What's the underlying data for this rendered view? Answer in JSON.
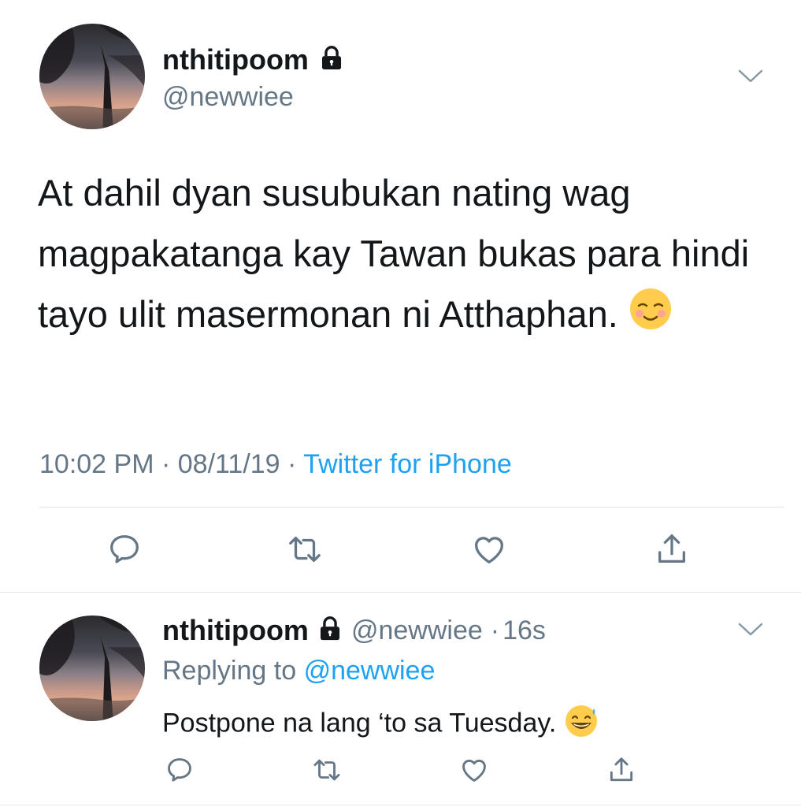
{
  "main_tweet": {
    "display_name": "nthitipoom",
    "handle": "@newwiee",
    "text": "At dahil dyan susubukan nating wag magpakatanga kay Tawan bukas para hindi tayo ulit masermonan ni Atthaphan.",
    "emoji": "relieved-smiling-face",
    "time": "10:02 PM",
    "date": "08/11/19",
    "source": "Twitter for iPhone"
  },
  "reply_tweet": {
    "display_name": "nthitipoom",
    "handle": "@newwiee",
    "age": "16s",
    "replying_prefix": "Replying to",
    "replying_to": "@newwiee",
    "text": "Postpone na lang ‘to sa Tuesday.",
    "emoji": "grinning-sweat-face"
  },
  "colors": {
    "text": "#14171a",
    "secondary": "#657786",
    "link": "#1da1f2",
    "divider": "#e1e8ed"
  }
}
